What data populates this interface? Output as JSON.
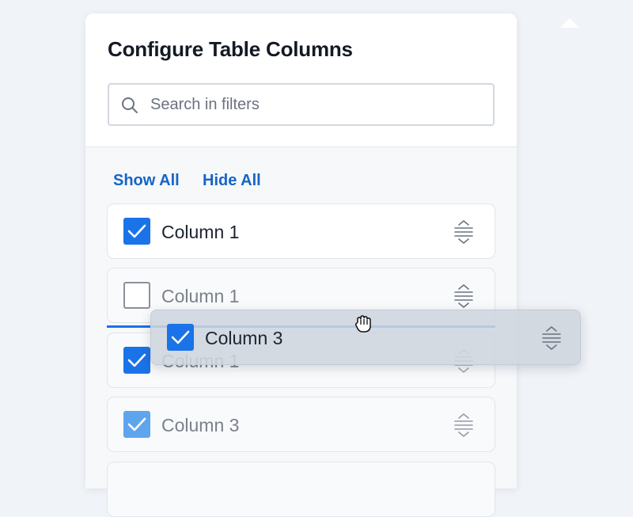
{
  "panel": {
    "title": "Configure Table Columns",
    "search": {
      "placeholder": "Search in filters",
      "value": ""
    },
    "actions": {
      "show_all": "Show All",
      "hide_all": "Hide All"
    },
    "rows": [
      {
        "label": "Column 1",
        "checked": true
      },
      {
        "label": "Column 1",
        "checked": false
      },
      {
        "label": "Column 1",
        "checked": true
      },
      {
        "label": "Column 3",
        "checked": true
      }
    ]
  },
  "drag": {
    "label": "Column 3",
    "checked": true
  },
  "colors": {
    "accent": "#1a73e8",
    "link": "#1565c8",
    "checkbox_light": "#5fa5ee",
    "text": "#141a24",
    "muted_text": "#7a818b"
  },
  "icons": {
    "search": "search-icon",
    "check": "check-icon",
    "drag_handle": "drag-handle-icon",
    "cursor": "grab-cursor-icon"
  }
}
